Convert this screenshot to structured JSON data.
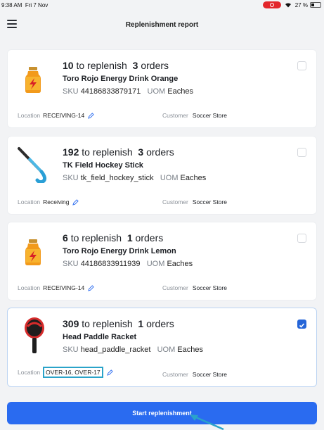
{
  "status": {
    "time": "9:38 AM",
    "date": "Fri 7 Nov",
    "battery": "27 %"
  },
  "header": {
    "title": "Replenishment report"
  },
  "labels": {
    "to_replenish": "to replenish",
    "orders": "orders",
    "sku": "SKU",
    "uom": "UOM",
    "location": "Location",
    "customer": "Customer"
  },
  "items": [
    {
      "qty": "10",
      "orders": "3",
      "name": "Toro Rojo Energy Drink Orange",
      "sku": "44186833879171",
      "uom": "Eaches",
      "location": "RECEIVING-14",
      "customer": "Soccer Store",
      "checked": false,
      "image": "energy-drink-bottle"
    },
    {
      "qty": "192",
      "orders": "3",
      "name": "TK Field Hockey Stick",
      "sku": "tk_field_hockey_stick",
      "uom": "Eaches",
      "location": "Receiving",
      "customer": "Soccer Store",
      "checked": false,
      "image": "hockey-stick"
    },
    {
      "qty": "6",
      "orders": "1",
      "name": "Toro Rojo Energy Drink Lemon",
      "sku": "44186833911939",
      "uom": "Eaches",
      "location": "RECEIVING-14",
      "customer": "Soccer Store",
      "checked": false,
      "image": "energy-drink-bottle"
    },
    {
      "qty": "309",
      "orders": "1",
      "name": "Head Paddle Racket",
      "sku": "head_paddle_racket",
      "uom": "Eaches",
      "location": "OVER-16, OVER-17",
      "customer": "Soccer Store",
      "checked": true,
      "image": "paddle-racket"
    }
  ],
  "cta": {
    "label": "Start replenishment"
  },
  "colors": {
    "primary": "#2a6bf0",
    "highlight": "#2aa3c9",
    "record": "#e3262b"
  }
}
